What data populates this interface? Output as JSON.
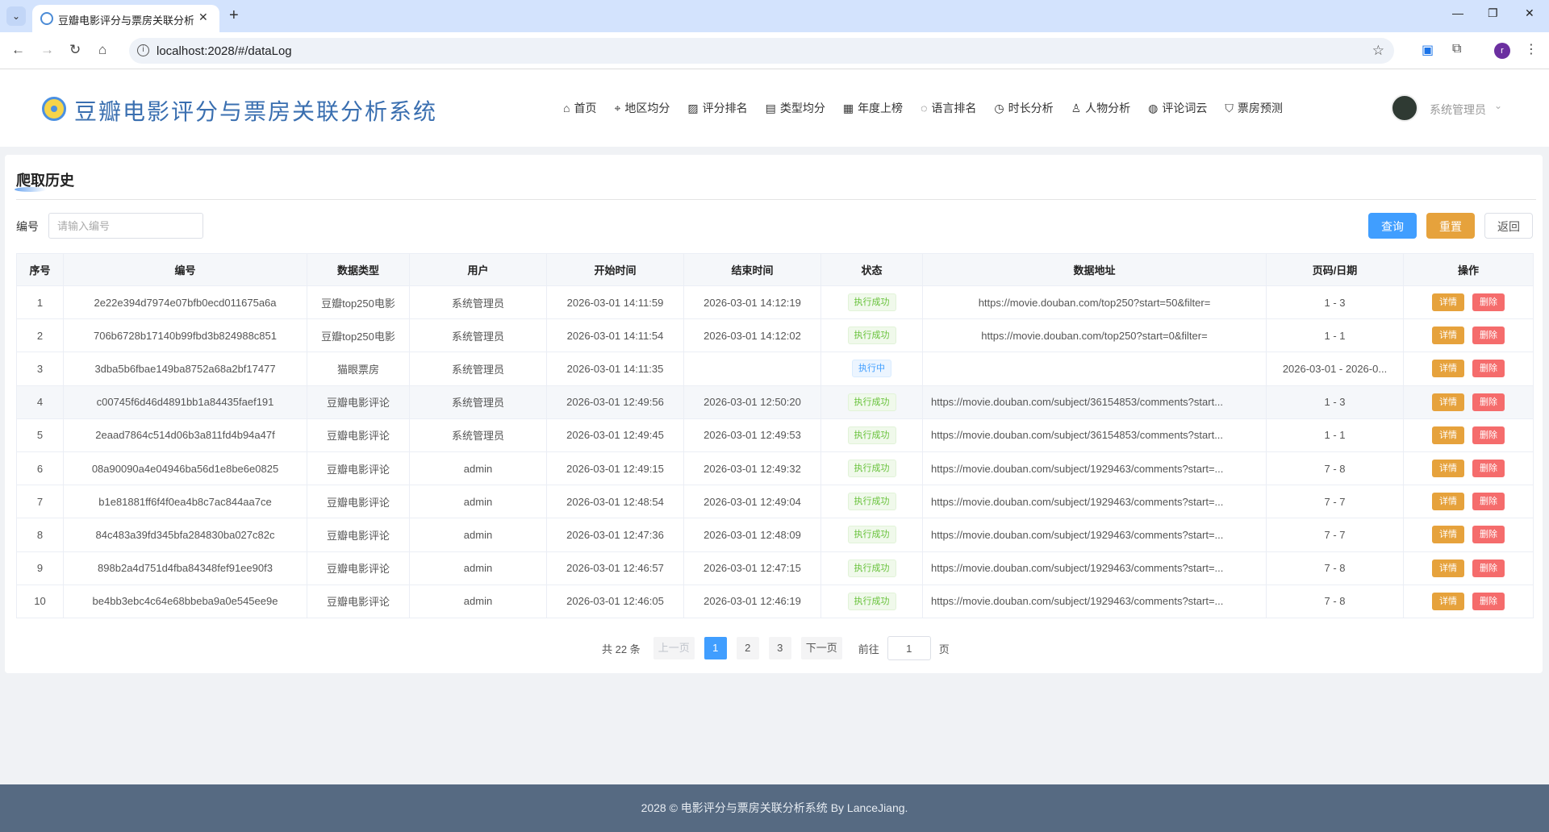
{
  "browser": {
    "tab_title": "豆瓣电影评分与票房关联分析系",
    "url": "localhost:2028/#/dataLog"
  },
  "header": {
    "title": "豆瓣电影评分与票房关联分析系统",
    "menu": [
      {
        "label": "首页",
        "icon": "home-icon",
        "glyph": "⌂"
      },
      {
        "label": "地区均分",
        "icon": "location-icon",
        "glyph": "⌖"
      },
      {
        "label": "评分排名",
        "icon": "chart-icon",
        "glyph": "▨"
      },
      {
        "label": "类型均分",
        "icon": "save-icon",
        "glyph": "▤"
      },
      {
        "label": "年度上榜",
        "icon": "calendar-icon",
        "glyph": "▦"
      },
      {
        "label": "语言排名",
        "icon": "chat-icon",
        "glyph": "◌"
      },
      {
        "label": "时长分析",
        "icon": "stopwatch-icon",
        "glyph": "◷"
      },
      {
        "label": "人物分析",
        "icon": "user-icon",
        "glyph": "♙"
      },
      {
        "label": "评论词云",
        "icon": "comment-icon",
        "glyph": "◍"
      },
      {
        "label": "票房预测",
        "icon": "cart-icon",
        "glyph": "⛉"
      }
    ],
    "user_name": "系统管理员"
  },
  "page": {
    "title": "爬取历史",
    "search_label": "编号",
    "search_placeholder": "请输入编号",
    "search_value": "",
    "buttons": {
      "query": "查询",
      "reset": "重置",
      "back": "返回"
    }
  },
  "table": {
    "columns": [
      "序号",
      "编号",
      "数据类型",
      "用户",
      "开始时间",
      "结束时间",
      "状态",
      "数据地址",
      "页码/日期",
      "操作"
    ],
    "action_detail": "详情",
    "action_delete": "删除",
    "rows": [
      {
        "no": "1",
        "id": "2e22e394d7974e07bfb0ecd011675a6a",
        "type": "豆瓣top250电影",
        "user": "系统管理员",
        "start": "2026-03-01 14:11:59",
        "end": "2026-03-01 14:12:19",
        "status": "执行成功",
        "status_kind": "success",
        "url": "https://movie.douban.com/top250?start=50&filter=",
        "url_align": "center",
        "page": "1 - 3"
      },
      {
        "no": "2",
        "id": "706b6728b17140b99fbd3b824988c851",
        "type": "豆瓣top250电影",
        "user": "系统管理员",
        "start": "2026-03-01 14:11:54",
        "end": "2026-03-01 14:12:02",
        "status": "执行成功",
        "status_kind": "success",
        "url": "https://movie.douban.com/top250?start=0&filter=",
        "url_align": "center",
        "page": "1 - 1"
      },
      {
        "no": "3",
        "id": "3dba5b6fbae149ba8752a68a2bf17477",
        "type": "猫眼票房",
        "user": "系统管理员",
        "start": "2026-03-01 14:11:35",
        "end": "",
        "status": "执行中",
        "status_kind": "running",
        "url": "",
        "url_align": "center",
        "page": "2026-03-01 - 2026-0..."
      },
      {
        "no": "4",
        "id": "c00745f6d46d4891bb1a84435faef191",
        "type": "豆瓣电影评论",
        "user": "系统管理员",
        "start": "2026-03-01 12:49:56",
        "end": "2026-03-01 12:50:20",
        "status": "执行成功",
        "status_kind": "success",
        "url": "https://movie.douban.com/subject/36154853/comments?start...",
        "url_align": "left",
        "page": "1 - 3"
      },
      {
        "no": "5",
        "id": "2eaad7864c514d06b3a811fd4b94a47f",
        "type": "豆瓣电影评论",
        "user": "系统管理员",
        "start": "2026-03-01 12:49:45",
        "end": "2026-03-01 12:49:53",
        "status": "执行成功",
        "status_kind": "success",
        "url": "https://movie.douban.com/subject/36154853/comments?start...",
        "url_align": "left",
        "page": "1 - 1"
      },
      {
        "no": "6",
        "id": "08a90090a4e04946ba56d1e8be6e0825",
        "type": "豆瓣电影评论",
        "user": "admin",
        "start": "2026-03-01 12:49:15",
        "end": "2026-03-01 12:49:32",
        "status": "执行成功",
        "status_kind": "success",
        "url": "https://movie.douban.com/subject/1929463/comments?start=...",
        "url_align": "left",
        "page": "7 - 8"
      },
      {
        "no": "7",
        "id": "b1e81881ff6f4f0ea4b8c7ac844aa7ce",
        "type": "豆瓣电影评论",
        "user": "admin",
        "start": "2026-03-01 12:48:54",
        "end": "2026-03-01 12:49:04",
        "status": "执行成功",
        "status_kind": "success",
        "url": "https://movie.douban.com/subject/1929463/comments?start=...",
        "url_align": "left",
        "page": "7 - 7"
      },
      {
        "no": "8",
        "id": "84c483a39fd345bfa284830ba027c82c",
        "type": "豆瓣电影评论",
        "user": "admin",
        "start": "2026-03-01 12:47:36",
        "end": "2026-03-01 12:48:09",
        "status": "执行成功",
        "status_kind": "success",
        "url": "https://movie.douban.com/subject/1929463/comments?start=...",
        "url_align": "left",
        "page": "7 - 7"
      },
      {
        "no": "9",
        "id": "898b2a4d751d4fba84348fef91ee90f3",
        "type": "豆瓣电影评论",
        "user": "admin",
        "start": "2026-03-01 12:46:57",
        "end": "2026-03-01 12:47:15",
        "status": "执行成功",
        "status_kind": "success",
        "url": "https://movie.douban.com/subject/1929463/comments?start=...",
        "url_align": "left",
        "page": "7 - 8"
      },
      {
        "no": "10",
        "id": "be4bb3ebc4c64e68bbeba9a0e545ee9e",
        "type": "豆瓣电影评论",
        "user": "admin",
        "start": "2026-03-01 12:46:05",
        "end": "2026-03-01 12:46:19",
        "status": "执行成功",
        "status_kind": "success",
        "url": "https://movie.douban.com/subject/1929463/comments?start=...",
        "url_align": "left",
        "page": "7 - 8"
      }
    ]
  },
  "pagination": {
    "total_text": "共 22 条",
    "prev": "上一页",
    "next": "下一页",
    "pages": [
      "1",
      "2",
      "3"
    ],
    "current": "1",
    "goto_label": "前往",
    "goto_value": "1",
    "goto_unit": "页"
  },
  "footer": {
    "text": "2028 © 电影评分与票房关联分析系统 By LanceJiang."
  },
  "colors": {
    "primary": "#409eff",
    "warning": "#e6a23c",
    "danger": "#f56c6c",
    "success": "#67c23a",
    "title_blue": "#3a6fb0",
    "footer_bg": "#566a82"
  }
}
